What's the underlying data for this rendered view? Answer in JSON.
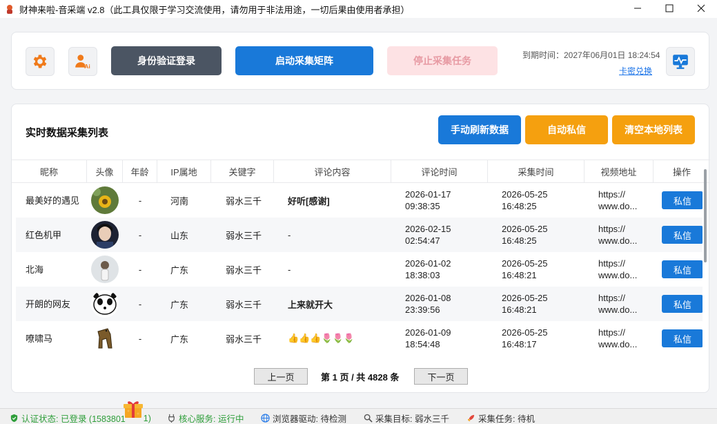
{
  "window": {
    "title": "财神来啦-音采端 v2.8（此工具仅限于学习交流使用，请勿用于非法用途，一切后果由使用者承担）"
  },
  "top": {
    "login_label": "身份验证登录",
    "start_label": "启动采集矩阵",
    "stop_label": "停止采集任务",
    "expiry_text": "到期时间：2027年06月01日 18:24:54",
    "redeem_label": "卡密兑换"
  },
  "main": {
    "title": "实时数据采集列表",
    "refresh_label": "手动刷新数据",
    "auto_dm_label": "自动私信",
    "clear_label": "清空本地列表"
  },
  "table": {
    "headers": [
      "昵称",
      "头像",
      "年龄",
      "IP属地",
      "关键字",
      "评论内容",
      "评论时间",
      "采集时间",
      "视频地址",
      "操作"
    ],
    "rows": [
      {
        "nickname": "最美好的遇见",
        "age": "-",
        "ip": "河南",
        "keyword": "弱水三千",
        "comment": "好听[感谢]",
        "comment_date": "2026-01-17",
        "comment_time": "09:38:35",
        "collect_date": "2026-05-25",
        "collect_time": "16:48:25",
        "url1": "https://",
        "url2": "www.do...",
        "action": "私信"
      },
      {
        "nickname": "红色机甲",
        "age": "-",
        "ip": "山东",
        "keyword": "弱水三千",
        "comment": "-",
        "comment_date": "2026-02-15",
        "comment_time": "02:54:47",
        "collect_date": "2026-05-25",
        "collect_time": "16:48:25",
        "url1": "https://",
        "url2": "www.do...",
        "action": "私信"
      },
      {
        "nickname": "北海",
        "age": "-",
        "ip": "广东",
        "keyword": "弱水三千",
        "comment": "-",
        "comment_date": "2026-01-02",
        "comment_time": "18:38:03",
        "collect_date": "2026-05-25",
        "collect_time": "16:48:21",
        "url1": "https://",
        "url2": "www.do...",
        "action": "私信"
      },
      {
        "nickname": "开朗的网友",
        "age": "-",
        "ip": "广东",
        "keyword": "弱水三千",
        "comment": "上来就开大",
        "comment_date": "2026-01-08",
        "comment_time": "23:39:56",
        "collect_date": "2026-05-25",
        "collect_time": "16:48:21",
        "url1": "https://",
        "url2": "www.do...",
        "action": "私信"
      },
      {
        "nickname": "嘹啸马",
        "age": "-",
        "ip": "广东",
        "keyword": "弱水三千",
        "comment": "👍👍👍🌷🌷🌷",
        "comment_date": "2026-01-09",
        "comment_time": "18:54:48",
        "collect_date": "2026-05-25",
        "collect_time": "16:48:17",
        "url1": "https://",
        "url2": "www.do...",
        "action": "私信"
      }
    ]
  },
  "pager": {
    "prev_label": "上一页",
    "info": "第 1 页 / 共 4828 条",
    "next_label": "下一页"
  },
  "status": {
    "auth": "认证状态: 已登录 (1583801",
    "auth_tail": "1)",
    "core": "核心服务: 运行中",
    "browser": "浏览器驱动: 待检测",
    "target": "采集目标: 弱水三千",
    "task": "采集任务: 待机"
  },
  "colors": {
    "dark_btn": "#4b5563",
    "blue_btn": "#1979d9",
    "stop_btn": "#fde2e4",
    "stop_text": "#e79aa3",
    "orange_btn": "#f5a00f",
    "status_green": "#2e9e3a",
    "link_blue": "#1a73e8"
  }
}
